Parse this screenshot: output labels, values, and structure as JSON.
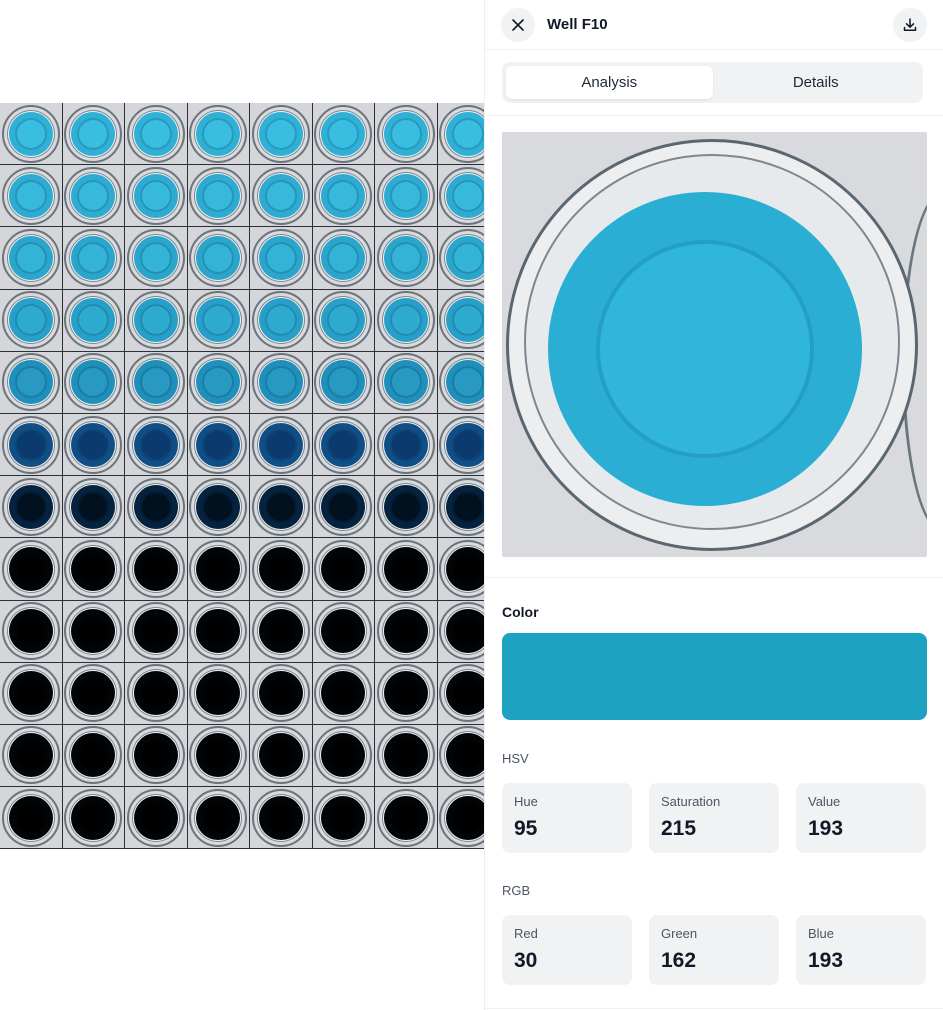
{
  "header": {
    "title": "Well F10"
  },
  "tabs": [
    {
      "label": "Analysis",
      "active": true
    },
    {
      "label": "Details",
      "active": false
    }
  ],
  "color_section": {
    "title": "Color",
    "swatch_color": "#1EA2C1"
  },
  "hsv": {
    "label": "HSV",
    "items": [
      {
        "name": "Hue",
        "value": "95"
      },
      {
        "name": "Saturation",
        "value": "215"
      },
      {
        "name": "Value",
        "value": "193"
      }
    ]
  },
  "rgb": {
    "label": "RGB",
    "items": [
      {
        "name": "Red",
        "value": "30"
      },
      {
        "name": "Green",
        "value": "162"
      },
      {
        "name": "Blue",
        "value": "193"
      }
    ]
  },
  "plate": {
    "row_colors": [
      "#2fb0d6",
      "#2eabd2",
      "#2aa6cd",
      "#26a0c8",
      "#1f8fbb",
      "#0f4f86",
      "#05223e",
      "#020508",
      "#020508",
      "#020508",
      "#020508",
      "#020508"
    ],
    "row_core_colors": [
      "#39bde0",
      "#36b9dd",
      "#33b3d8",
      "#2ea9d0",
      "#2799c3",
      "#0a3a6e",
      "#02111f",
      "#000000",
      "#000000",
      "#000000",
      "#000000",
      "#000000"
    ]
  }
}
